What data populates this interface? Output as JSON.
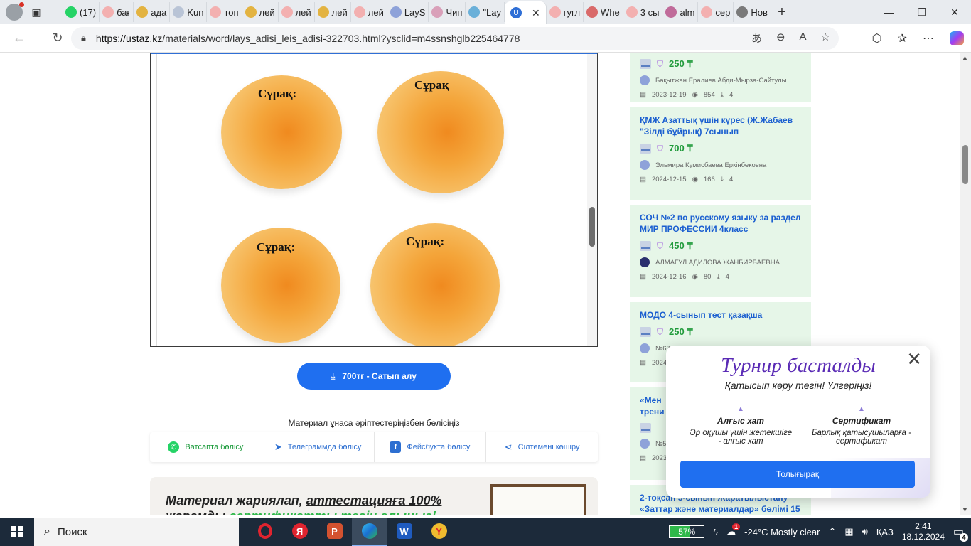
{
  "browser": {
    "tabs": [
      {
        "label": "(17)",
        "icon": "whatsapp-icon",
        "color": "#25d366"
      },
      {
        "label": "бағ",
        "icon": "yandex-icon",
        "color": "#f3b0b0"
      },
      {
        "label": "ада",
        "icon": "image-icon",
        "color": "#e3b341"
      },
      {
        "label": "Kun",
        "icon": "site-icon",
        "color": "#b9c4d6"
      },
      {
        "label": "топ",
        "icon": "yandex-icon",
        "color": "#f3b0b0"
      },
      {
        "label": "лей",
        "icon": "image-icon",
        "color": "#e3b341"
      },
      {
        "label": "лей",
        "icon": "yandex-icon",
        "color": "#f3b0b0"
      },
      {
        "label": "лей",
        "icon": "image-icon",
        "color": "#e3b341"
      },
      {
        "label": "лей",
        "icon": "yandex-icon",
        "color": "#f3b0b0"
      },
      {
        "label": "LayS",
        "icon": "ustaz-icon",
        "color": "#8ea2d9"
      },
      {
        "label": "Чип",
        "icon": "t-icon",
        "color": "#d9a0b9"
      },
      {
        "label": "\"Lay",
        "icon": "grid-icon",
        "color": "#6ab0d9"
      }
    ],
    "active_tab_icon_letter": "U",
    "tabs_after": [
      {
        "label": "гугл",
        "icon": "yandex-icon",
        "color": "#f3b0b0"
      },
      {
        "label": "Whe",
        "icon": "photo-icon",
        "color": "#d96a6a"
      },
      {
        "label": "3 сы",
        "icon": "yandex-icon",
        "color": "#f3b0b0"
      },
      {
        "label": "alm",
        "icon": "doc-icon",
        "color": "#c06b9a"
      },
      {
        "label": "сер",
        "icon": "yandex-icon",
        "color": "#f3b0b0"
      },
      {
        "label": "Нов",
        "icon": "newtab-icon",
        "color": "#7a7a7a"
      }
    ],
    "url_host": "https://ustaz.kz",
    "url_path": "/materials/word/lays_adisi_leis_adisi-322703.html?ysclid=m4ssnshglb225464778"
  },
  "document": {
    "chip_labels": [
      "Сұрақ:",
      "Сұрақ",
      "Сұрақ:",
      "Сұрақ:"
    ]
  },
  "buy_button": "700тг - Сатып алу",
  "share": {
    "title": "Материал ұнаса әріптестеріңізбен бөлісіңіз",
    "whatsapp": "Ватсапта бөлісу",
    "telegram": "Телеграммда бөлісу",
    "facebook": "Фейсбукта бөлісу",
    "copy": "Сілтемені көшіру"
  },
  "promo": {
    "line1a": "Материал жариялап, ",
    "line1b": "аттестацияға 100%",
    "line2a": "жарамды ",
    "line2b": "сертификатты тегін алыңыз!"
  },
  "cards": [
    {
      "title": "",
      "price": "250 ₸",
      "author": "Бақытжан Ералиев Абди-Мырза-Сайтулы",
      "date": "2023-12-19",
      "views": "854",
      "downloads": "4"
    },
    {
      "title": "ҚМЖ Азаттық үшін күрес (Ж.Жабаев \"Зілді бұйрық) 7сынып",
      "price": "700 ₸",
      "author": "Эльмира Кумисбаева Еркінбековна",
      "date": "2024-12-15",
      "views": "166",
      "downloads": "4"
    },
    {
      "title": "СОЧ №2 по русскому языку за раздел МИР ПРОФЕССИИ 4класс",
      "price": "450 ₸",
      "author": "АЛМАГУЛ АДИЛОВА ЖАНБИРБАЕВНА",
      "date": "2024-12-16",
      "views": "80",
      "downloads": "4"
    },
    {
      "title": "МОДО 4-сынып тест қазақша",
      "price": "250 ₸",
      "author": "№67",
      "date": "2024",
      "views": "",
      "downloads": ""
    },
    {
      "title": "«Мен трени",
      "price": "",
      "author": "№5",
      "date": "2023",
      "views": "",
      "downloads": ""
    },
    {
      "title": "2-тоқсан 5-сынып Жаратылыстану «Заттар және материалдар» бөлімі 15",
      "price": "",
      "author": "",
      "date": "",
      "views": "",
      "downloads": ""
    }
  ],
  "popup": {
    "title": "Турнир басталды",
    "subtitle": "Қатысып көру тегін! Үлгеріңіз!",
    "benefit1_title": "Алғыс хат",
    "benefit1_text": "Әр оқушы үшін жетекшіге - алғыс хат",
    "benefit2_title": "Сертификат",
    "benefit2_text": "Барлық қатысушыларға - сертификат",
    "button": "Толығырақ"
  },
  "taskbar": {
    "search": "Поиск",
    "battery": "57%",
    "battery_level": 0.57,
    "weather": "-24°C  Mostly clear",
    "lang": "ҚАЗ",
    "time": "2:41",
    "date": "18.12.2024",
    "notifications": "4",
    "weather_badge": "1"
  }
}
